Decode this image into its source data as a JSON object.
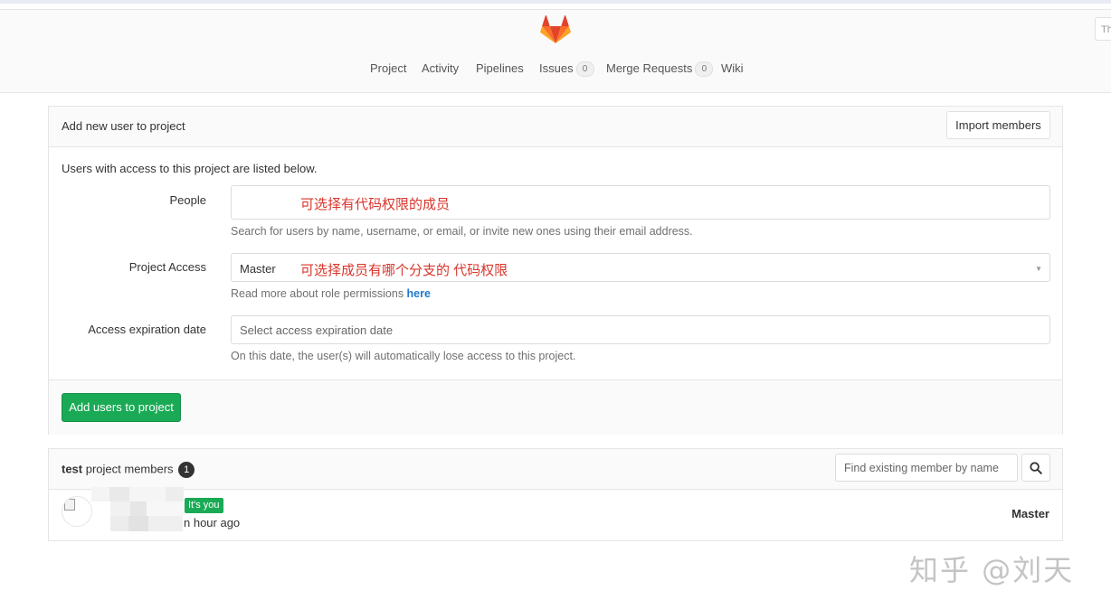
{
  "nav": {
    "items": [
      {
        "label": "Project"
      },
      {
        "label": "Activity"
      },
      {
        "label": "Pipelines"
      },
      {
        "label": "Issues",
        "count": "0"
      },
      {
        "label": "Merge Requests",
        "count": "0"
      },
      {
        "label": "Wiki"
      }
    ],
    "right_edge_text": "Th"
  },
  "add_panel": {
    "title": "Add new user to project",
    "import_label": "Import members",
    "intro": "Users with access to this project are listed below.",
    "people": {
      "label": "People",
      "annotation": "可选择有代码权限的成员",
      "help": "Search for users by name, username, or email, or invite new ones using their email address."
    },
    "access": {
      "label": "Project Access",
      "value": "Master",
      "annotation": "可选择成员有哪个分支的 代码权限",
      "help_prefix": "Read more about role permissions ",
      "help_link": "here"
    },
    "expiration": {
      "label": "Access expiration date",
      "placeholder": "Select access expiration date",
      "help": "On this date, the user(s) will automatically lose access to this project."
    },
    "submit_label": "Add users to project"
  },
  "members": {
    "project_name": "test",
    "title_suffix": " project members",
    "count": "1",
    "search_placeholder": "Find existing member by name",
    "rows": [
      {
        "badge": "It's you",
        "time": "n hour ago",
        "role": "Master"
      }
    ]
  },
  "watermark": "知乎 @刘天",
  "colors": {
    "primary_green": "#1aaa55",
    "link_blue": "#1f78d1",
    "annotation_red": "#d9352b"
  }
}
